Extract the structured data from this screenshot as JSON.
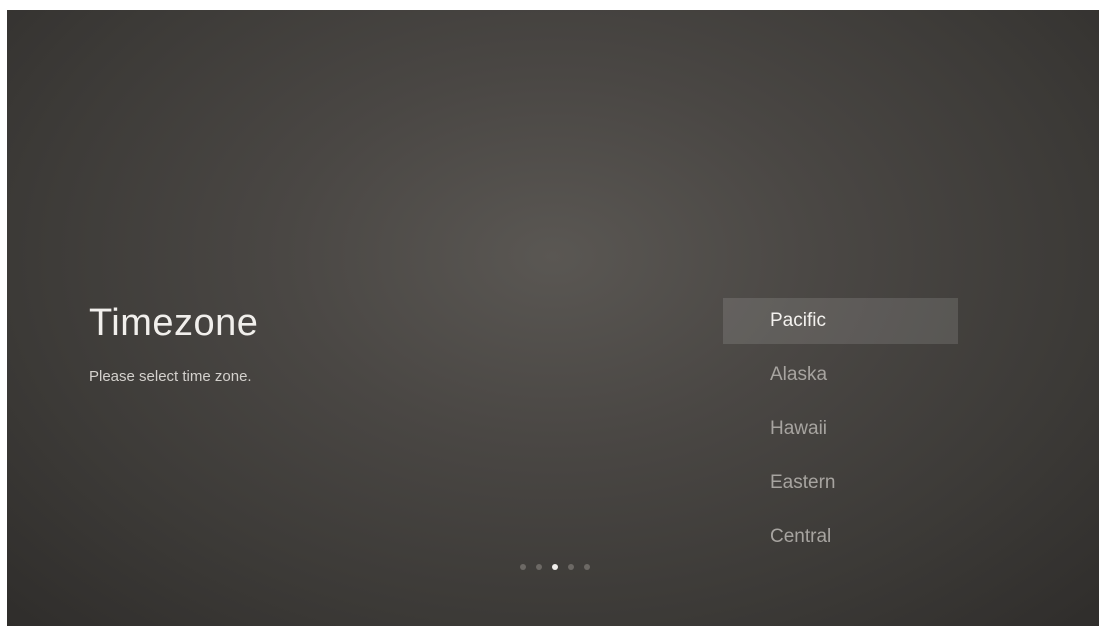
{
  "screen": {
    "title": "Timezone",
    "subtitle": "Please select time zone."
  },
  "timezones": [
    {
      "label": "Pacific",
      "selected": true
    },
    {
      "label": "Alaska",
      "selected": false
    },
    {
      "label": "Hawaii",
      "selected": false
    },
    {
      "label": "Eastern",
      "selected": false
    },
    {
      "label": "Central",
      "selected": false
    }
  ],
  "pager": {
    "total_steps": 5,
    "current_step": 3
  },
  "colors": {
    "background": "#4a4744",
    "selection_highlight": "#5e5b58",
    "active_dot": "#f0eeeb"
  }
}
